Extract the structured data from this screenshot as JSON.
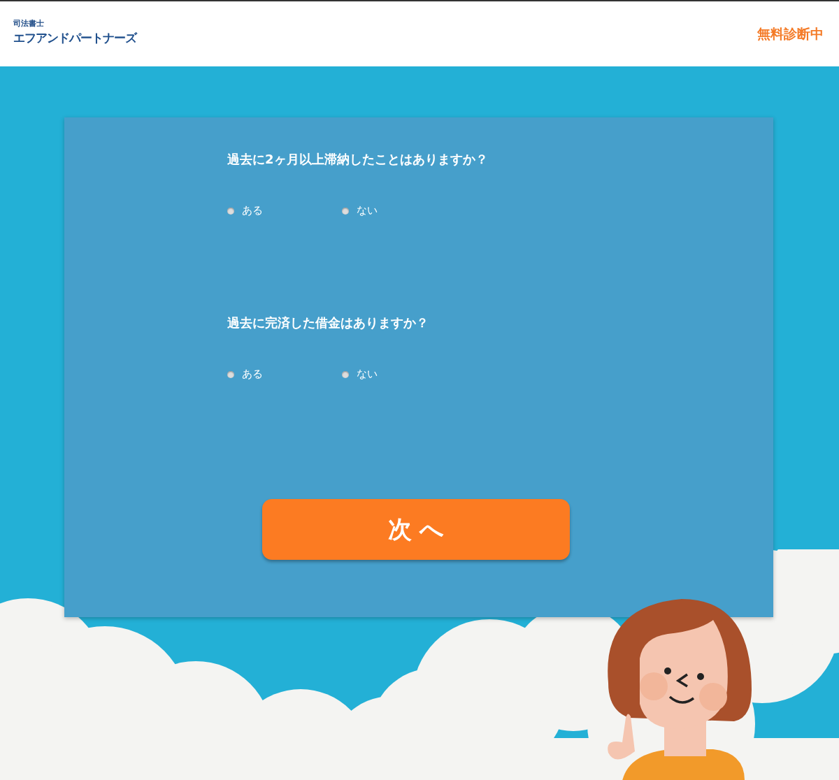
{
  "header": {
    "logo_subtitle": "司法書士",
    "logo_title": "エフアンドパートナーズ",
    "status": "無料診断中"
  },
  "questions": [
    {
      "text": "過去に2ヶ月以上滞納したことはありますか？",
      "options": [
        {
          "label": "ある",
          "selected": false
        },
        {
          "label": "ない",
          "selected": false
        }
      ]
    },
    {
      "text": "過去に完済した借金はありますか？",
      "options": [
        {
          "label": "ある",
          "selected": false
        },
        {
          "label": "ない",
          "selected": false
        }
      ]
    }
  ],
  "next_button": "次 へ"
}
